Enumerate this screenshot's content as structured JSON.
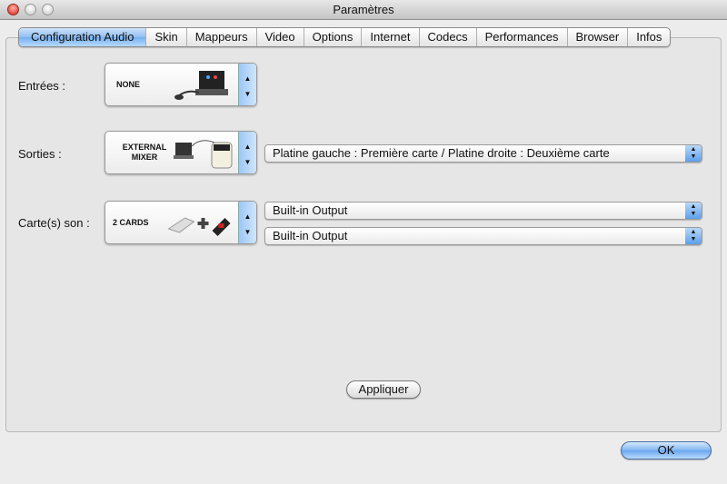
{
  "window": {
    "title": "Paramètres"
  },
  "tabs": [
    "Configuration Audio",
    "Skin",
    "Mappeurs",
    "Video",
    "Options",
    "Internet",
    "Codecs",
    "Performances",
    "Browser",
    "Infos"
  ],
  "inputs": {
    "label": "Entrées :",
    "value": "NONE"
  },
  "outputs": {
    "label": "Sorties :",
    "value": "EXTERNAL MIXER",
    "routing": "Platine gauche : Première carte / Platine droite : Deuxième carte"
  },
  "soundcards": {
    "label": "Carte(s) son :",
    "value": "2 CARDS",
    "card1": "Built-in Output",
    "card2": "Built-in Output"
  },
  "apply_label": "Appliquer",
  "ok_label": "OK"
}
